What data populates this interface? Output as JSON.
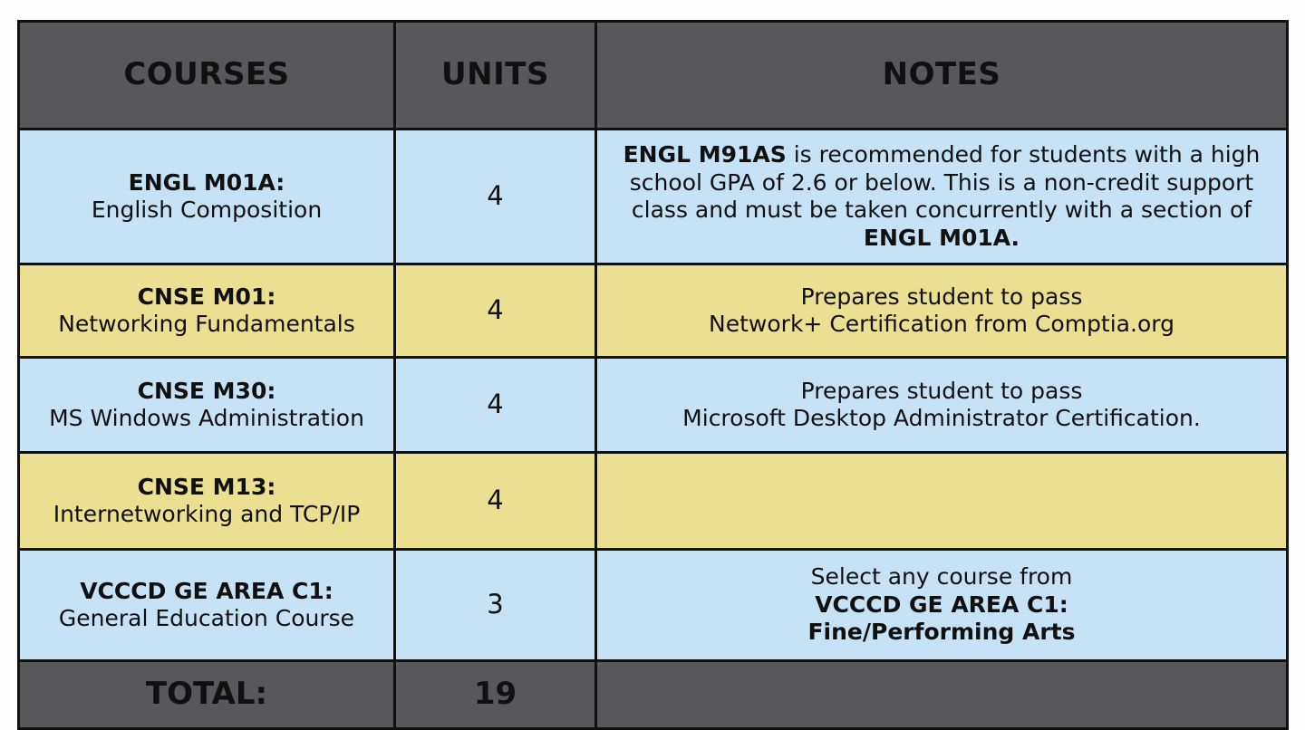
{
  "table": {
    "columns": [
      {
        "key": "courses",
        "label": "COURSES"
      },
      {
        "key": "units",
        "label": "UNITS"
      },
      {
        "key": "notes",
        "label": "NOTES"
      }
    ],
    "rows": [
      {
        "shade": "blue",
        "course_code": "ENGL M01A:",
        "course_title": "English Composition",
        "units": "4",
        "notes_segments": [
          {
            "text": "ENGL M91AS",
            "bold": true
          },
          {
            "text": " is recommended for students with a high school GPA of 2.6 or below. This is a non-credit support class and must be taken concurrently with a section of ",
            "bold": false
          },
          {
            "text": "ENGL M01A.",
            "bold": true
          }
        ]
      },
      {
        "shade": "yellow",
        "course_code": "CNSE M01:",
        "course_title": "Networking Fundamentals",
        "units": "4",
        "notes_segments": [
          {
            "text": "Prepares student to pass",
            "bold": false
          },
          {
            "text": "\n",
            "bold": false
          },
          {
            "text": "Network+ Certification from Comptia.org",
            "bold": false
          }
        ]
      },
      {
        "shade": "blue",
        "course_code": "CNSE M30:",
        "course_title": "MS Windows Administration",
        "units": "4",
        "notes_segments": [
          {
            "text": "Prepares student to pass",
            "bold": false
          },
          {
            "text": "\n",
            "bold": false
          },
          {
            "text": "Microsoft Desktop Administrator Certification.",
            "bold": false
          }
        ]
      },
      {
        "shade": "yellow",
        "course_code": "CNSE M13:",
        "course_title": "Internetworking and TCP/IP",
        "units": "4",
        "notes_segments": []
      },
      {
        "shade": "blue",
        "course_code": "VCCCD GE AREA C1:",
        "course_title": "General Education Course",
        "units": "3",
        "notes_segments": [
          {
            "text": "Select any course from",
            "bold": false
          },
          {
            "text": "\n",
            "bold": false
          },
          {
            "text": "VCCCD GE AREA C1:",
            "bold": true
          },
          {
            "text": "\n",
            "bold": false
          },
          {
            "text": "Fine/Performing Arts",
            "bold": true
          }
        ]
      }
    ],
    "total": {
      "label": "TOTAL:",
      "units": "19",
      "notes": ""
    }
  },
  "colors": {
    "header_background": "#58585A",
    "header_text": "#FFFFFF",
    "row_blue": "#C6E2F5",
    "row_yellow": "#EBDF92",
    "border": "#111111",
    "page_background": "#FEFEFE",
    "body_text": "#101010"
  }
}
